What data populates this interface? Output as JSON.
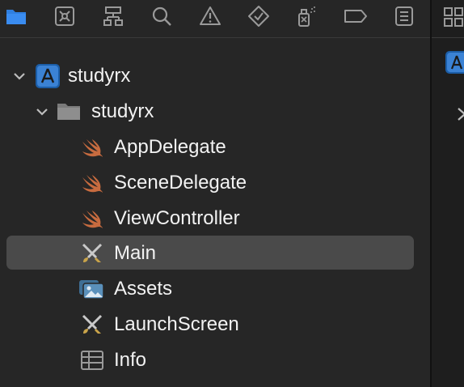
{
  "navigator": {
    "toolbar_icons": [
      {
        "name": "folder-icon",
        "color": "#2f7fe0"
      },
      {
        "name": "source-control-icon"
      },
      {
        "name": "hierarchy-icon"
      },
      {
        "name": "search-icon"
      },
      {
        "name": "issue-warning-icon"
      },
      {
        "name": "test-diamond-icon"
      },
      {
        "name": "debug-spray-icon"
      },
      {
        "name": "breakpoint-icon"
      },
      {
        "name": "report-icon"
      }
    ],
    "tree": {
      "project": {
        "label": "studyrx",
        "icon": "xcode-project-icon",
        "expanded": true
      },
      "group": {
        "label": "studyrx",
        "icon": "folder-icon",
        "expanded": true
      },
      "files": [
        {
          "label": "AppDelegate",
          "icon": "swift-icon"
        },
        {
          "label": "SceneDelegate",
          "icon": "swift-icon"
        },
        {
          "label": "ViewController",
          "icon": "swift-icon"
        },
        {
          "label": "Main",
          "icon": "storyboard-icon",
          "selected": true
        },
        {
          "label": "Assets",
          "icon": "asset-catalog-icon"
        },
        {
          "label": "LaunchScreen",
          "icon": "storyboard-icon"
        },
        {
          "label": "Info",
          "icon": "plist-icon"
        }
      ]
    }
  },
  "colors": {
    "accent": "#2f7fe0",
    "swift_orange": "#c76b3f",
    "selection": "#4a4a4a",
    "text": "#f2f2f2"
  }
}
